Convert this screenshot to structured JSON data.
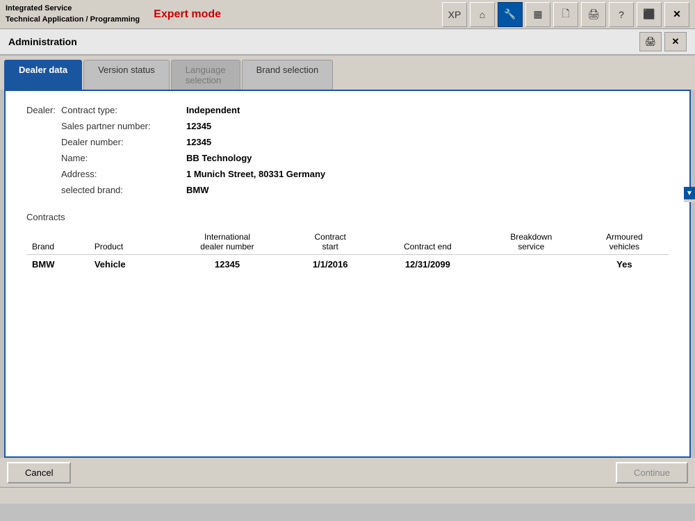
{
  "titleBar": {
    "appLine1": "Integrated Service",
    "appLine2": "Technical Application / Programming",
    "expertMode": "Expert mode"
  },
  "toolbar": {
    "buttons": [
      {
        "name": "xp-button",
        "label": "XP",
        "active": false
      },
      {
        "name": "home-button",
        "label": "🏠",
        "active": false
      },
      {
        "name": "wrench-button",
        "label": "🔧",
        "active": true
      },
      {
        "name": "barcode-button",
        "label": "▦",
        "active": false
      },
      {
        "name": "page-button",
        "label": "📄",
        "active": false
      },
      {
        "name": "print-button",
        "label": "🖨",
        "active": false
      },
      {
        "name": "help-button",
        "label": "?",
        "active": false
      },
      {
        "name": "export-button",
        "label": "⬛",
        "active": false
      },
      {
        "name": "close-button",
        "label": "✕",
        "active": false
      }
    ]
  },
  "adminBar": {
    "title": "Administration",
    "printLabel": "🖨",
    "closeLabel": "✕"
  },
  "tabs": [
    {
      "name": "dealer-data-tab",
      "label": "Dealer data",
      "active": true,
      "disabled": false
    },
    {
      "name": "version-status-tab",
      "label": "Version status",
      "active": false,
      "disabled": false
    },
    {
      "name": "language-selection-tab",
      "label": "Language selection",
      "active": false,
      "disabled": true
    },
    {
      "name": "brand-selection-tab",
      "label": "Brand selection",
      "active": false,
      "disabled": false
    }
  ],
  "dealerSection": {
    "sectionLabel": "Dealer:",
    "fields": [
      {
        "label": "Contract type:",
        "value": "Independent"
      },
      {
        "label": "Sales partner number:",
        "value": "12345"
      },
      {
        "label": "Dealer number:",
        "value": "12345"
      },
      {
        "label": "Name:",
        "value": "BB Technology"
      },
      {
        "label": "Address:",
        "value": "1 Munich Street, 80331 Germany"
      },
      {
        "label": "selected brand:",
        "value": "BMW"
      }
    ]
  },
  "contractsSection": {
    "title": "Contracts",
    "columns": [
      {
        "key": "brand",
        "label": "Brand"
      },
      {
        "key": "product",
        "label": "Product"
      },
      {
        "key": "intlDealerNumber",
        "label": "International dealer number"
      },
      {
        "key": "contractStart",
        "label": "Contract start"
      },
      {
        "key": "contractEnd",
        "label": "Contract end"
      },
      {
        "key": "breakdownService",
        "label": "Breakdown service"
      },
      {
        "key": "armouredVehicles",
        "label": "Armoured vehicles"
      }
    ],
    "rows": [
      {
        "brand": "BMW",
        "product": "Vehicle",
        "intlDealerNumber": "12345",
        "contractStart": "1/1/2016",
        "contractEnd": "12/31/2099",
        "breakdownService": "",
        "armouredVehicles": "Yes"
      }
    ]
  },
  "buttons": {
    "cancel": "Cancel",
    "continue": "Continue"
  },
  "scrollArrow": "▶"
}
